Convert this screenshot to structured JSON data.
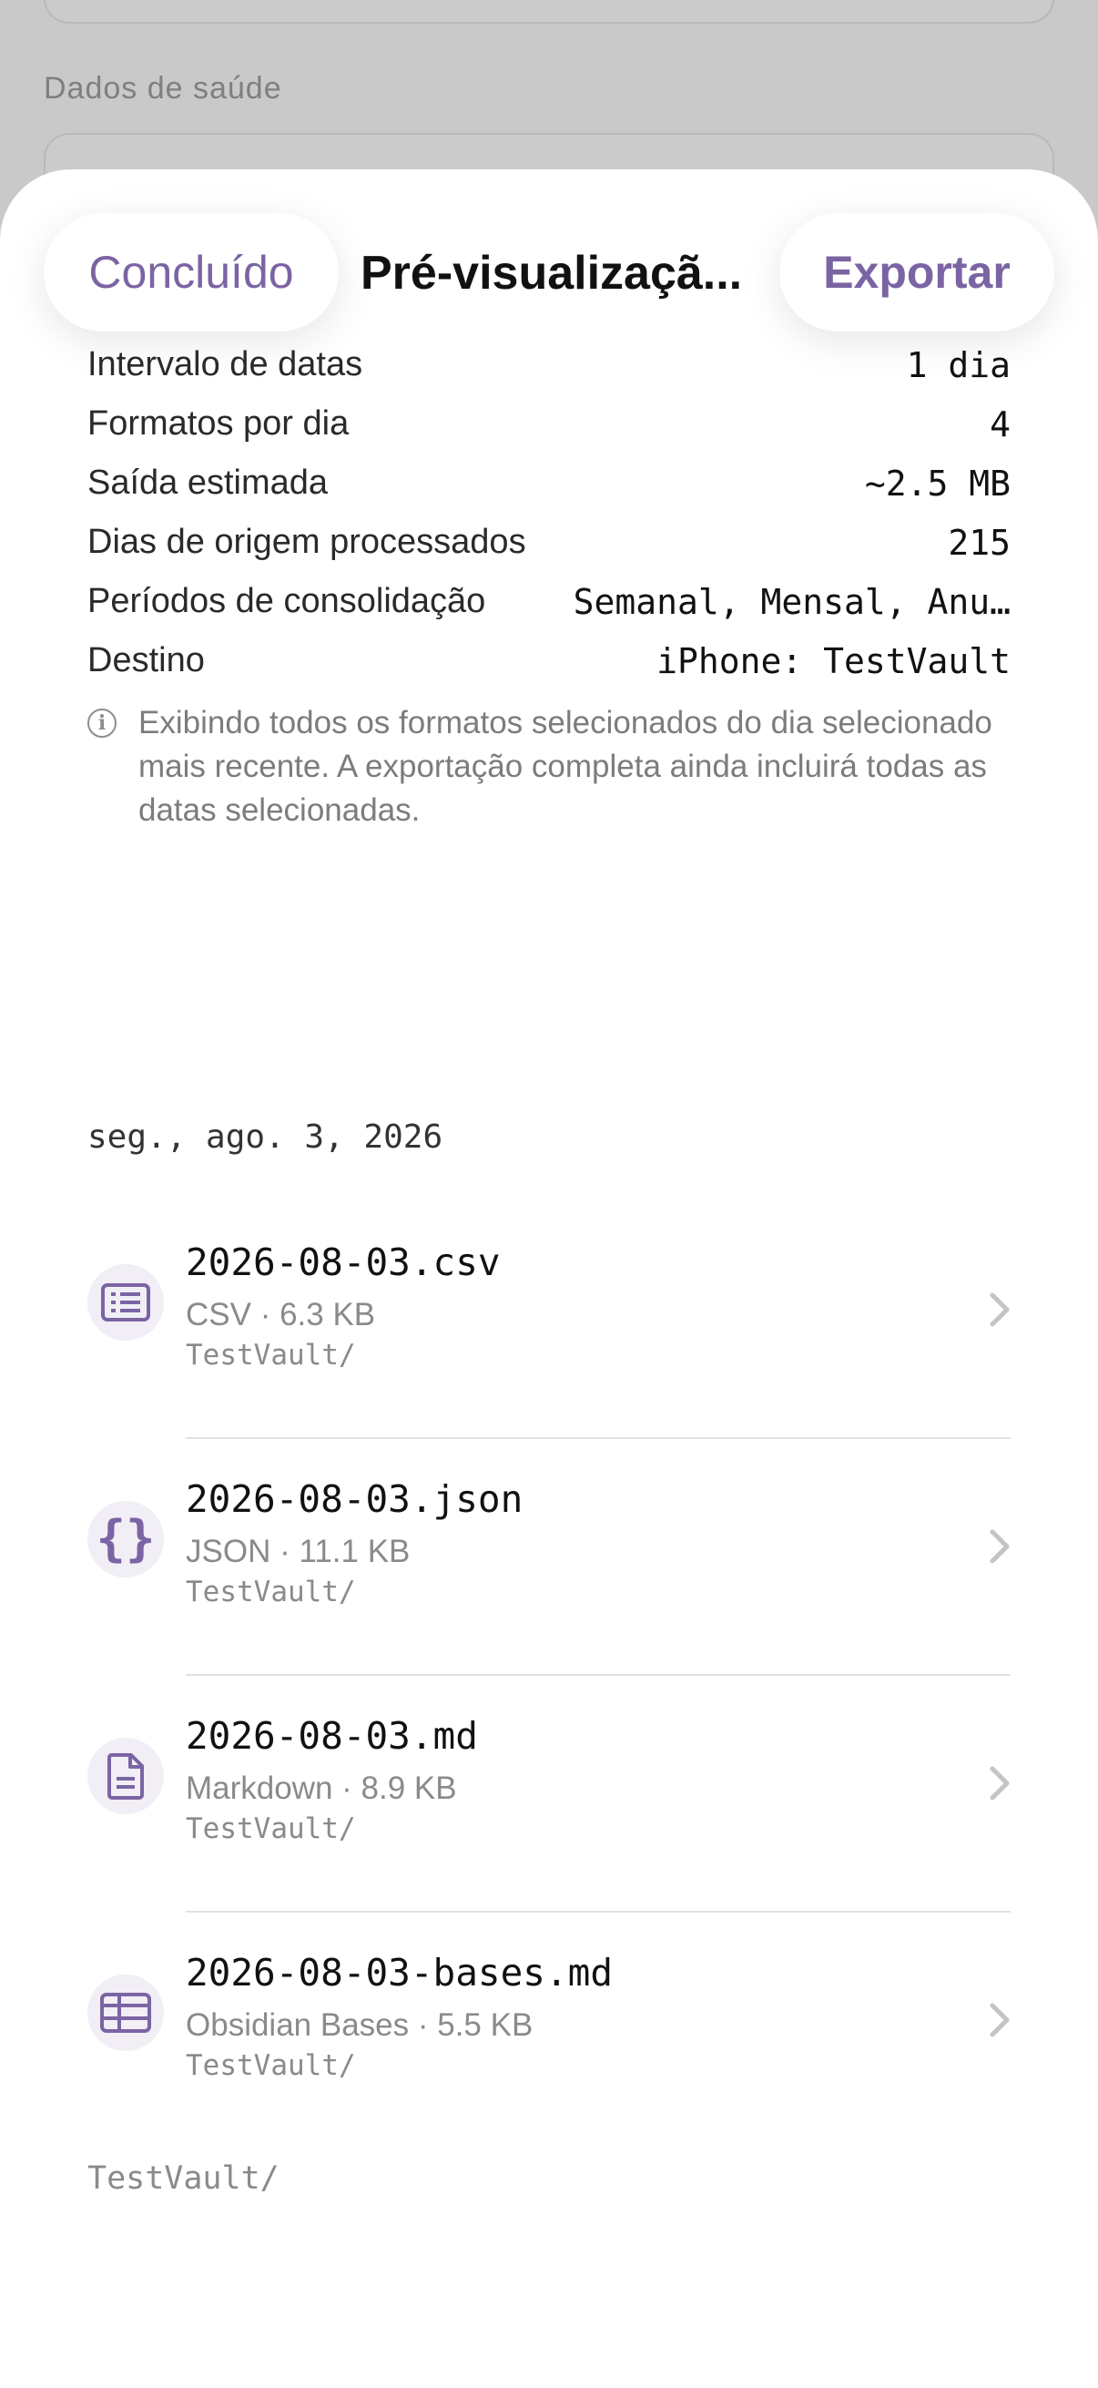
{
  "background": {
    "section_label": "Dados de saúde"
  },
  "sheet": {
    "done_label": "Concluído",
    "title": "Pré-visualizaçã...",
    "export_label": "Exportar",
    "accent_color": "#7b64a3"
  },
  "summary": [
    {
      "label": "Intervalo de datas",
      "value": "1 dia"
    },
    {
      "label": "Formatos por dia",
      "value": "4"
    },
    {
      "label": "Saída estimada",
      "value": "~2.5 MB"
    },
    {
      "label": "Dias de origem processados",
      "value": "215"
    },
    {
      "label": "Períodos de consolidação",
      "value": "Semanal, Mensal, Anu…"
    },
    {
      "label": "Destino",
      "value": "iPhone: TestVault"
    }
  ],
  "note": "Exibindo todos os formatos selecionados do dia selecionado mais recente. A exportação completa ainda incluirá todas as datas selecionadas.",
  "date_header": "seg., ago. 3, 2026",
  "files": [
    {
      "name": "2026-08-03.csv",
      "meta": "CSV · 6.3 KB",
      "path": "TestVault/",
      "icon": "list-doc-icon"
    },
    {
      "name": "2026-08-03.json",
      "meta": "JSON · 11.1 KB",
      "path": "TestVault/",
      "icon": "curly-braces-icon"
    },
    {
      "name": "2026-08-03.md",
      "meta": "Markdown · 8.9 KB",
      "path": "TestVault/",
      "icon": "document-icon"
    },
    {
      "name": "2026-08-03-bases.md",
      "meta": "Obsidian Bases · 5.5 KB",
      "path": "TestVault/",
      "icon": "table-icon"
    }
  ],
  "footer_path": "TestVault/"
}
